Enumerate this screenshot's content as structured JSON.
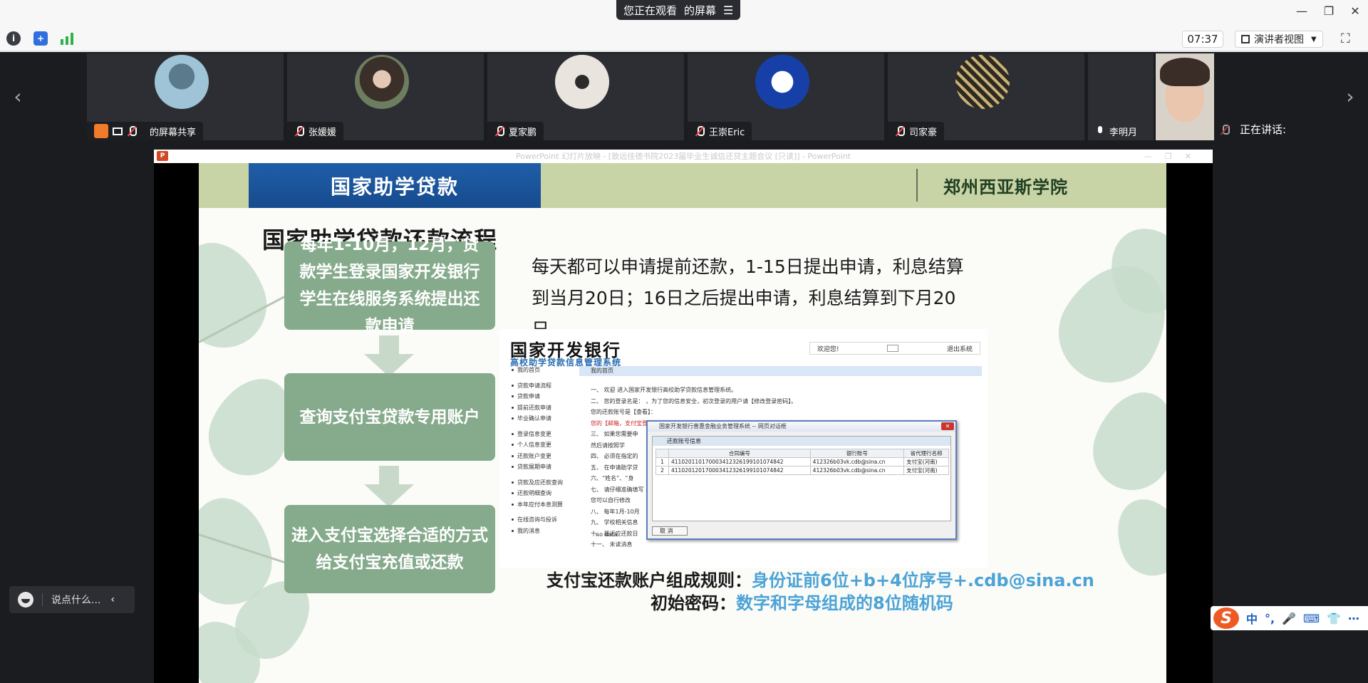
{
  "top": {
    "share_status": "您正在观看",
    "share_target": "的屏幕",
    "timer": "07:37",
    "presenter_view": "演讲者视图"
  },
  "participants": [
    {
      "name": "的屏幕共享"
    },
    {
      "name": "张媛媛"
    },
    {
      "name": "夏家鹏"
    },
    {
      "name": "王崇Eric"
    },
    {
      "name": "司家豪"
    },
    {
      "name": "李明月"
    }
  ],
  "speaking_label": "正在讲话:",
  "ppt": {
    "window_title": "PowerPoint 幻灯片放映 - [致远佳德书院2023届毕业生诚信还贷主题会议 [只读]] - PowerPoint"
  },
  "slide": {
    "header_title": "国家助学贷款",
    "school": "郑州西亚斯学院",
    "title": "国家助学贷款还款流程",
    "steps": [
      "每年1-10月，12月，贷款学生登录国家开发银行学生在线服务系统提出还款申请",
      "查询支付宝贷款专用账户",
      "进入支付宝选择合适的方式给支付宝充值或还款"
    ],
    "info": "每天都可以申请提前还款，1-15日提出申请，利息结算到当月20日；16日之后提出申请，利息结算到下月20日。",
    "rule1_label": "支付宝还款账户组成规则：",
    "rule1_value": "身份证前6位+b+4位序号+.cdb@sina.cn",
    "rule2_label": "初始密码：",
    "rule2_value": "数字和字母组成的8位随机码"
  },
  "bank": {
    "name": "国家开发银行",
    "subtitle": "高校助学贷款信息管理系统",
    "welcome": "欢迎您!",
    "logout": "退出系统",
    "main_header": "我的首页",
    "nav": [
      "我的首页",
      "贷款申请流程",
      "贷款申请",
      "提前还款申请",
      "毕业确认申请",
      "登录信息变更",
      "个人信息变更",
      "还款账户变更",
      "贷款展期申请",
      "贷款及应还款查询",
      "还款明细查询",
      "本年应付本息测算",
      "在线咨询与投诉",
      "我的消息"
    ],
    "lines": [
      "一、 欢迎        进入国家开发银行高校助学贷款信息管理系统。",
      "二、 您的登录名是：                    ，为了您的信息安全，初次登录的用户请【修改登录密码】。",
      "      您的还款账号是【查看】：",
      "      您的【邮箱，支付宝登录及支付】初始密码是：g9q961s0，为了安全，请分别登录【新浪邮箱】和【支付宝】修改您的初始密码。",
      "三、 如果您需要申",
      "      然后请按照学",
      "四、 必须在指定的",
      "五、 在申请助学贷",
      "六、“姓名”、“身",
      "七、 请仔细准确填写",
      "      您可以自行修改",
      "八、 每年1月-10月",
      "九、 学校相关信息",
      "十、 最近应还款日",
      "十一、 未读消息"
    ],
    "no_data": "no data",
    "dialog": {
      "title": "国家开发银行普惠金融业务管理系统 -- 网页对话框",
      "close": "✕",
      "section": "还款账号信息",
      "headers": [
        "",
        "合同编号",
        "银行账号",
        "省代理行名称"
      ],
      "rows": [
        [
          "1",
          "41102011017000341232619910107484​2",
          "412326b03vk.cdb@sina.cn",
          "支付宝(河南)"
        ],
        [
          "2",
          "41102012017000341232619910107484​2",
          "412326b03vk.cdb@sina.cn",
          "支付宝(河南)"
        ]
      ],
      "cancel": "取 消"
    }
  },
  "chat": {
    "placeholder": "说点什么..."
  },
  "ime": {
    "items": [
      "中",
      "°,",
      "🎤",
      "⌨",
      "👕",
      "⋯"
    ]
  }
}
